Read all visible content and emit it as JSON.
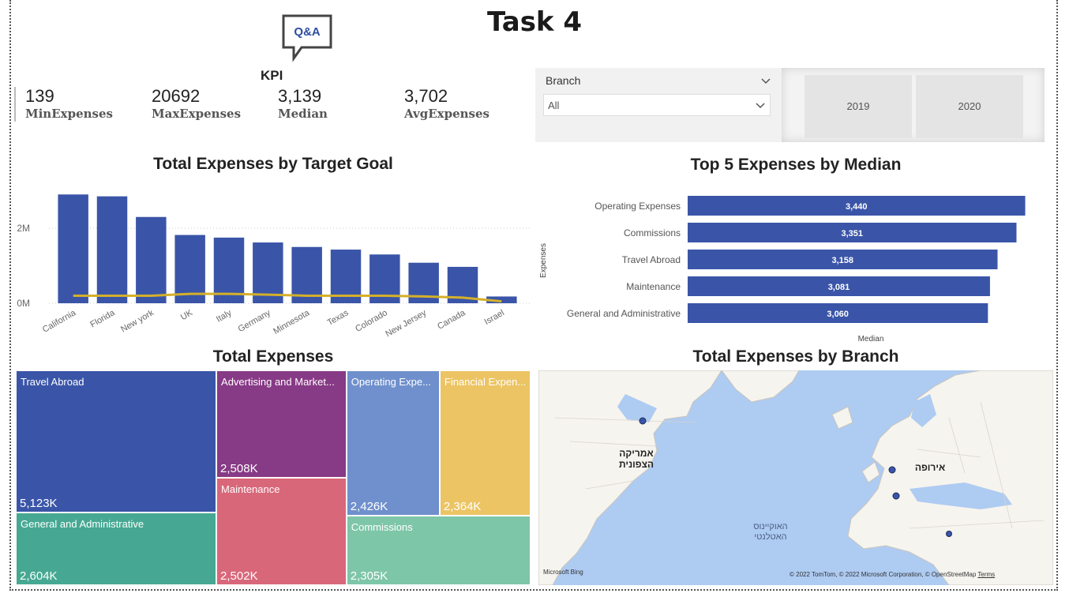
{
  "page": {
    "title": "Task 4"
  },
  "qa": {
    "label": "Q&A"
  },
  "kpi": {
    "heading": "KPI",
    "cards": [
      {
        "value": "139",
        "label": "MinExpenses"
      },
      {
        "value": "20692",
        "label": "MaxExpenses"
      },
      {
        "value": "3,139",
        "label": "Median"
      },
      {
        "value": "3,702",
        "label": "AvgExpenses"
      }
    ]
  },
  "slicer": {
    "header": "Branch",
    "value": "All"
  },
  "year_slicer": {
    "options": [
      "2019",
      "2020"
    ]
  },
  "charts": {
    "goal_title": "Total Expenses by Target Goal",
    "top5_title": "Top 5 Expenses by Median",
    "treemap_title": "Total Expenses",
    "map_title": "Total Expenses by Branch"
  },
  "chart_data": [
    {
      "type": "bar",
      "title": "Total Expenses by Target Goal",
      "categories": [
        "California",
        "Florida",
        "New york",
        "UK",
        "Italy",
        "Germany",
        "Minnesota",
        "Texas",
        "Colorado",
        "New Jersey",
        "Canada",
        "Israel"
      ],
      "series": [
        {
          "type": "bar",
          "values": [
            2.9,
            2.85,
            2.3,
            1.82,
            1.75,
            1.62,
            1.5,
            1.43,
            1.3,
            1.08,
            0.97,
            0.18
          ]
        },
        {
          "type": "line",
          "values": [
            0.2,
            0.2,
            0.2,
            0.25,
            0.25,
            0.23,
            0.2,
            0.2,
            0.2,
            0.18,
            0.15,
            0.05
          ]
        }
      ],
      "yticks": [
        "0M",
        "2M"
      ],
      "ylim": [
        0,
        3.2
      ],
      "colors": {
        "bar": "#3a55a8",
        "line": "#d4b02a"
      }
    },
    {
      "type": "bar",
      "orientation": "horizontal",
      "title": "Top 5 Expenses by Median",
      "categories": [
        "Operating Expenses",
        "Commissions",
        "Travel Abroad",
        "Maintenance",
        "General and Administrative"
      ],
      "values": [
        3440,
        3351,
        3158,
        3081,
        3060
      ],
      "value_labels": [
        "3,440",
        "3,351",
        "3,158",
        "3,081",
        "3,060"
      ],
      "xlabel": "Median",
      "ylabel": "Expenses",
      "xlim": [
        0,
        3500
      ],
      "colors": {
        "bar": "#3a55a8"
      }
    },
    {
      "type": "treemap",
      "title": "Total Expenses",
      "items": [
        {
          "name": "Travel Abroad",
          "value_label": "5,123K",
          "value": 5123,
          "color": "#3a55a8"
        },
        {
          "name": "General and Administrative",
          "value_label": "2,604K",
          "value": 2604,
          "color": "#46a892"
        },
        {
          "name": "Advertising and Market...",
          "value_label": "2,508K",
          "value": 2508,
          "color": "#873a85"
        },
        {
          "name": "Maintenance",
          "value_label": "2,502K",
          "value": 2502,
          "color": "#d9677a"
        },
        {
          "name": "Operating Expe...",
          "value_label": "2,426K",
          "value": 2426,
          "color": "#6f90cc"
        },
        {
          "name": "Financial Expen...",
          "value_label": "2,364K",
          "value": 2364,
          "color": "#ecc464"
        },
        {
          "name": "Commissions",
          "value_label": "2,305K",
          "value": 2305,
          "color": "#7ec6a8"
        }
      ]
    }
  ],
  "map": {
    "labels": {
      "north_america": "אמריקה הצפונית",
      "europe": "אירופה",
      "atlantic": "האוקיינוס האטלנטי"
    },
    "brand": "Microsoft Bing",
    "copyright": "© 2022 TomTom, © 2022 Microsoft Corporation, © OpenStreetMap",
    "terms": "Terms"
  }
}
